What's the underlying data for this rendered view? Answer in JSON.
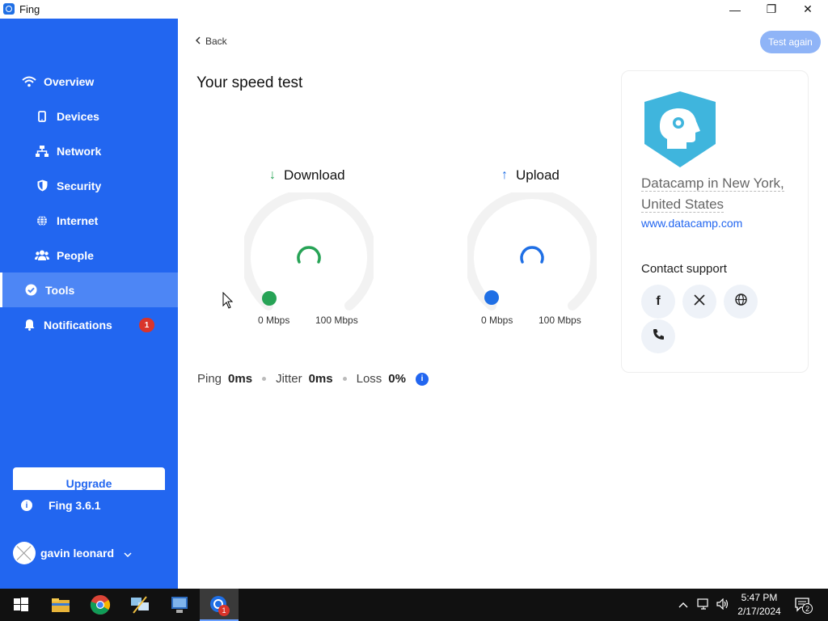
{
  "window": {
    "title": "Fing",
    "minimize": "—",
    "restore": "❐",
    "close": "✕"
  },
  "sidebar": {
    "items": [
      {
        "label": "Overview"
      },
      {
        "label": "Devices"
      },
      {
        "label": "Network"
      },
      {
        "label": "Security"
      },
      {
        "label": "Internet"
      },
      {
        "label": "People"
      },
      {
        "label": "Tools"
      },
      {
        "label": "Notifications",
        "badge": "1"
      }
    ],
    "upgrade": "Upgrade",
    "version": "Fing 3.6.1",
    "user": "gavin leonard"
  },
  "main": {
    "back": "Back",
    "test_again": "Test again",
    "title": "Your speed test",
    "download": {
      "label": "Download",
      "min": "0 Mbps",
      "max": "100 Mbps",
      "color": "#27a356"
    },
    "upload": {
      "label": "Upload",
      "min": "0 Mbps",
      "max": "100 Mbps",
      "color": "#1f6fe5"
    },
    "stats": {
      "ping_label": "Ping",
      "ping_value": "0ms",
      "jitter_label": "Jitter",
      "jitter_value": "0ms",
      "loss_label": "Loss",
      "loss_value": "0%"
    }
  },
  "isp_card": {
    "name": "Datacamp in New York, United States",
    "url": "www.datacamp.com",
    "contact_label": "Contact support",
    "buttons": [
      "facebook-icon",
      "x-icon",
      "globe-icon",
      "phone-icon"
    ]
  },
  "taskbar": {
    "time": "5:47 PM",
    "date": "2/17/2024",
    "notification_count": "2",
    "fing_badge": "1"
  },
  "colors": {
    "accent": "#2266f0",
    "download": "#27a356",
    "upload": "#1f6fe5",
    "badge": "#d9342b"
  }
}
